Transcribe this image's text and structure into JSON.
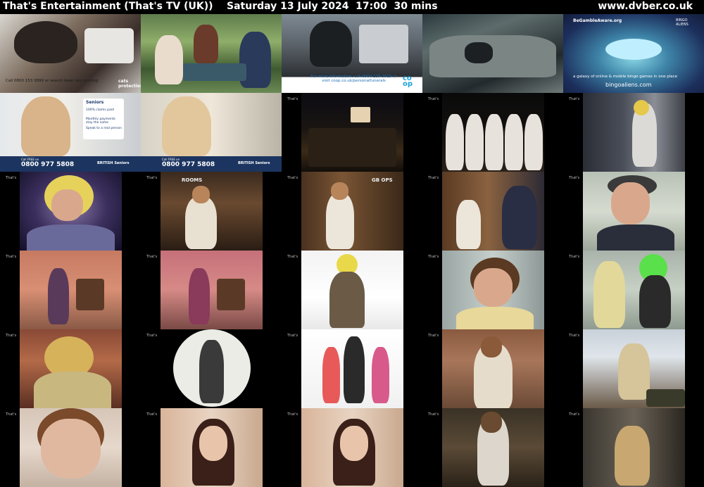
{
  "header": {
    "title": "That's Entertainment (That's TV (UK))    Saturday 13 July 2024  17:00  30 mins",
    "site": "www.dvber.co.uk"
  },
  "ad_text": {
    "cats_call": "Call 0800 153 3899 or search keep cats purring",
    "cats_logo": "cats protection",
    "coop_info": "For more information, call 0800 239 3919 or visit coop.co.uk/personalfunerals",
    "coop_logo": "co op",
    "gamble_aware": "BeGambleAware.org",
    "bingo_tag": "a galaxy of online & mobile bingo games in one place",
    "bingo_url": "bingoaliens.com",
    "bingo_brand": "BINGO ALIENS",
    "seniors_title": "Seniors",
    "seniors_points": [
      "100% claims paid",
      "Monthly payments stay the same",
      "Speak to a real person"
    ],
    "seniors_phone": "0800 977 5808",
    "seniors_brand": "BRITISH Seniors",
    "seniors_phone_prefix": "Call FREE on",
    "sign_rooms": "ROOMS",
    "sign_gb_ops": "GB OPS",
    "channel_logo": "That's"
  }
}
